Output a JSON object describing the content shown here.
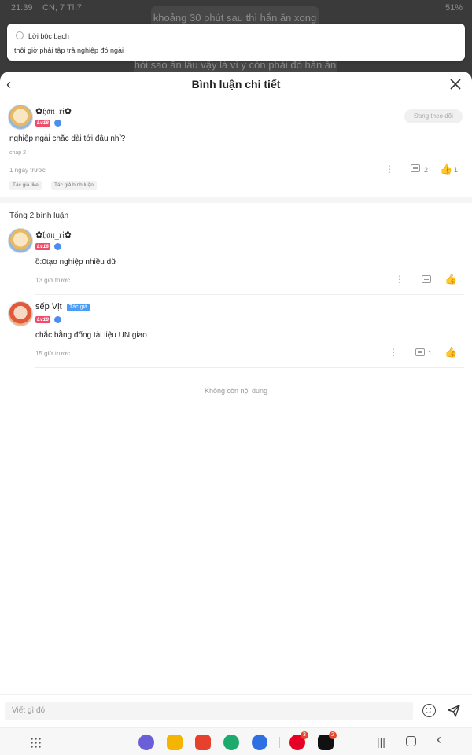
{
  "status_bar": {
    "time": "21:39",
    "day": "CN, 7 Th7",
    "battery": "51%"
  },
  "background": {
    "line1": "khoảng 30 phút sau thì hắn ăn xong",
    "line2": "hỏi sao ăn lâu vậy là vì y còn phải đỏ hắn ăn"
  },
  "notification": {
    "title": "Lời bộc bạch",
    "text": "thôi giờ phải tập trả nghiệp đó ngài"
  },
  "header": {
    "title": "Bình luận chi tiết"
  },
  "main_comment": {
    "username": "✿𝔥𝔞𝔫_𝔯𝔦✿",
    "level": "Lv18",
    "follow_label": "Đang theo dõi",
    "text": "nghiệp ngài chắc dài tới đâu nhỉ?",
    "chapter": "chap 2",
    "time": "1 ngày trước",
    "reply_count": "2",
    "like_count": "1",
    "tags": [
      "Tác giả like",
      "Tác giả bình luận"
    ]
  },
  "total_label": "Tổng 2 bình luận",
  "replies": [
    {
      "username": "✿𝔥𝔞𝔫_𝔯𝔦✿",
      "level": "Lv18",
      "author_tag": "",
      "text": "ồ:0tạo nghiệp nhiều dữ",
      "time": "13 giờ trước",
      "reply_count": ""
    },
    {
      "username": "sếp Vịt",
      "level": "Lv18",
      "author_tag": "Tác giả",
      "text": "chắc bằng đống tài liệu UN giao",
      "time": "15 giờ trước",
      "reply_count": "1"
    }
  ],
  "end_text": "Không còn nội dung",
  "input": {
    "placeholder": "Viết gì đó"
  },
  "dock": {
    "pinterest_badge": "3",
    "tiktok_badge": "2"
  },
  "colors": {
    "like_active": "#f04d6a",
    "badge_blue": "#4a8ef2",
    "author_tag": "#4a9cf5"
  }
}
